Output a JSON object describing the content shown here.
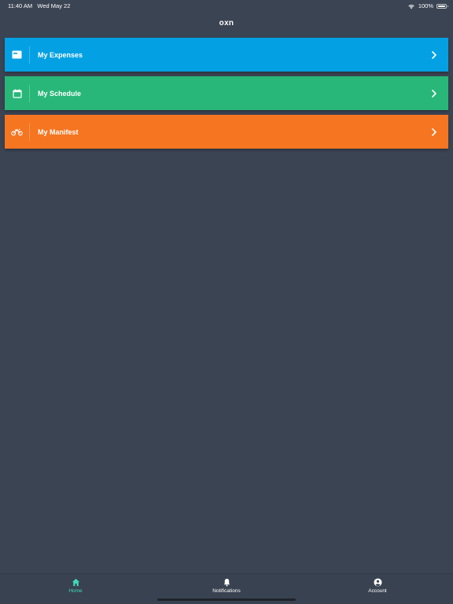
{
  "status_bar": {
    "time": "11:40 AM",
    "date": "Wed May 22",
    "battery": "100%"
  },
  "header": {
    "title": "oxn"
  },
  "menu": {
    "items": [
      {
        "label": "My Expenses",
        "icon": "card-icon",
        "color": "#03a1e3"
      },
      {
        "label": "My Schedule",
        "icon": "calendar-icon",
        "color": "#28b779"
      },
      {
        "label": "My Manifest",
        "icon": "motorbike-icon",
        "color": "#f57521"
      }
    ]
  },
  "tabbar": {
    "active_color": "#3fd9b8",
    "tabs": [
      {
        "label": "Home",
        "icon": "home-icon",
        "active": true
      },
      {
        "label": "Notifications",
        "icon": "bell-icon",
        "active": false
      },
      {
        "label": "Account",
        "icon": "user-circle-icon",
        "active": false
      }
    ]
  }
}
